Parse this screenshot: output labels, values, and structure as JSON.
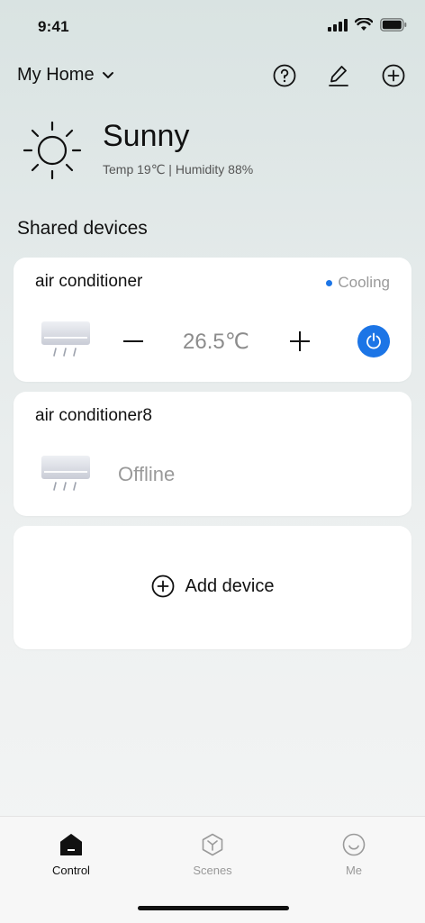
{
  "status_bar": {
    "time": "9:41",
    "icons": [
      "signal-icon",
      "wifi-icon",
      "battery-icon"
    ]
  },
  "header": {
    "home_name": "My Home",
    "icons": [
      "chevron-down-icon",
      "help-icon",
      "edit-icon",
      "add-circle-icon"
    ]
  },
  "weather": {
    "icon": "sun-icon",
    "condition": "Sunny",
    "detail": "Temp 19℃ | Humidity 88%"
  },
  "section_title": "Shared devices",
  "devices": [
    {
      "name": "air conditioner",
      "status": "Cooling",
      "icon": "air-conditioner-icon",
      "temperature": "26.5℃",
      "power_on": true
    },
    {
      "name": "air conditioner8",
      "status": "Offline",
      "icon": "air-conditioner-icon"
    }
  ],
  "add_device": {
    "label": "Add device",
    "icon": "add-circle-icon"
  },
  "tabs": [
    {
      "label": "Control",
      "icon": "home-icon",
      "active": true
    },
    {
      "label": "Scenes",
      "icon": "scenes-icon",
      "active": false
    },
    {
      "label": "Me",
      "icon": "smiley-icon",
      "active": false
    }
  ],
  "colors": {
    "accent": "#1c75e6",
    "muted_text": "#9a9a9a",
    "card_bg": "#ffffff"
  }
}
